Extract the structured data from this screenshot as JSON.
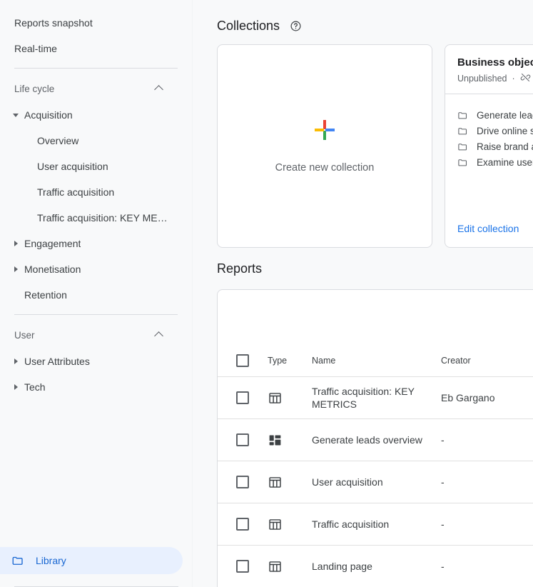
{
  "sidebar": {
    "top_items": [
      {
        "label": "Reports snapshot"
      },
      {
        "label": "Real-time"
      }
    ],
    "sections": [
      {
        "title": "Life cycle",
        "collapse_icon": "chevron-up-icon",
        "groups": [
          {
            "label": "Acquisition",
            "expanded": true,
            "icon": "triangle-down-icon",
            "children": [
              {
                "label": "Overview"
              },
              {
                "label": "User acquisition"
              },
              {
                "label": "Traffic acquisition"
              },
              {
                "label": "Traffic acquisition: KEY ME…"
              }
            ]
          },
          {
            "label": "Engagement",
            "expanded": false,
            "icon": "triangle-right-icon",
            "children": []
          },
          {
            "label": "Monetisation",
            "expanded": false,
            "icon": "triangle-right-icon",
            "children": []
          },
          {
            "label": "Retention",
            "expanded": false,
            "icon": "none",
            "children": []
          }
        ]
      },
      {
        "title": "User",
        "collapse_icon": "chevron-up-icon",
        "groups": [
          {
            "label": "User Attributes",
            "expanded": false,
            "icon": "triangle-right-icon",
            "children": []
          },
          {
            "label": "Tech",
            "expanded": false,
            "icon": "triangle-right-icon",
            "children": []
          }
        ]
      }
    ],
    "library": {
      "label": "Library",
      "icon": "folder-icon",
      "selected": true
    }
  },
  "main": {
    "collections": {
      "title": "Collections",
      "help_icon": "help-circle-icon",
      "create_card": {
        "icon": "google-plus-icon",
        "label": "Create new collection"
      },
      "cards": [
        {
          "title": "Business objectives",
          "status": "Unpublished",
          "separator": "·",
          "status_icon": "unpublish-link-icon",
          "items": [
            {
              "icon": "folder-icon",
              "label": "Generate leads"
            },
            {
              "icon": "folder-icon",
              "label": "Drive online sales"
            },
            {
              "icon": "folder-icon",
              "label": "Raise brand awareness"
            },
            {
              "icon": "folder-icon",
              "label": "Examine user behaviour"
            }
          ],
          "action_label": "Edit collection"
        }
      ]
    },
    "reports": {
      "title": "Reports",
      "columns": {
        "select_all": "select-all-checkbox",
        "type": "Type",
        "name": "Name",
        "creator": "Creator"
      },
      "rows": [
        {
          "type_icon": "detail-report-icon",
          "name": "Traffic acquisition: KEY METRICS",
          "creator": "Eb Gargano"
        },
        {
          "type_icon": "overview-report-icon",
          "name": "Generate leads overview",
          "creator": "-"
        },
        {
          "type_icon": "detail-report-icon",
          "name": "User acquisition",
          "creator": "-"
        },
        {
          "type_icon": "detail-report-icon",
          "name": "Traffic acquisition",
          "creator": "-"
        },
        {
          "type_icon": "detail-report-icon",
          "name": "Landing page",
          "creator": "-"
        }
      ]
    }
  },
  "colors": {
    "accent_blue": "#1a73e8",
    "selected_bg": "#e8f0fe",
    "selected_text": "#1967d2",
    "page_bg": "#f8f9fa",
    "card_bg": "#ffffff",
    "border": "#dadce0",
    "text_primary": "#202124",
    "text_secondary": "#5f6368",
    "plus_red": "#ea4335",
    "plus_yellow": "#fbbc04",
    "plus_green": "#34a853",
    "plus_blue": "#4285f4"
  }
}
